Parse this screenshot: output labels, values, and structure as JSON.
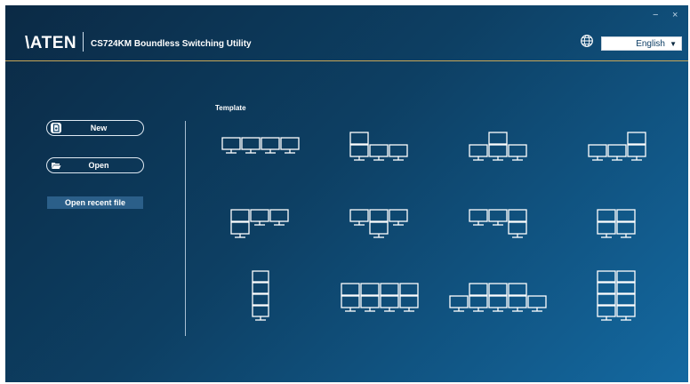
{
  "window": {
    "minimize_icon": "minimize-icon",
    "close_icon": "close-icon",
    "minimize_glyph": "−",
    "close_glyph": "×"
  },
  "header": {
    "logo": "\\ATEN",
    "title": "CS724KM Boundless Switching Utility",
    "language_icon": "globe-icon",
    "language": {
      "selected": "English",
      "arrow": "▼"
    }
  },
  "sidebar": {
    "new_label": "New",
    "new_icon": "new-file-icon",
    "open_label": "Open",
    "open_icon": "folder-open-icon",
    "recent_label": "Open recent file"
  },
  "templates": {
    "heading": "Template",
    "items": [
      {
        "name": "4 in a row"
      },
      {
        "name": "1 above left of 3 in a row"
      },
      {
        "name": "1 above middle of 3 in a row"
      },
      {
        "name": "1 above right of 3 in a row"
      },
      {
        "name": "3 in a row with 1 below left"
      },
      {
        "name": "3 in a row with 1 below middle"
      },
      {
        "name": "3 in a row with 1 below right"
      },
      {
        "name": "2 by 2 grid"
      },
      {
        "name": "4 in a column"
      },
      {
        "name": "2 rows of 4"
      },
      {
        "name": "3 above 5"
      },
      {
        "name": "2 by 4 grid"
      }
    ]
  },
  "colors": {
    "background_dark": "#0b2a45",
    "background_light": "#1469a1",
    "accent_line": "#c8a657",
    "monitor_stroke": "#ffffff",
    "recent_button_bg": "#2b5f89"
  }
}
